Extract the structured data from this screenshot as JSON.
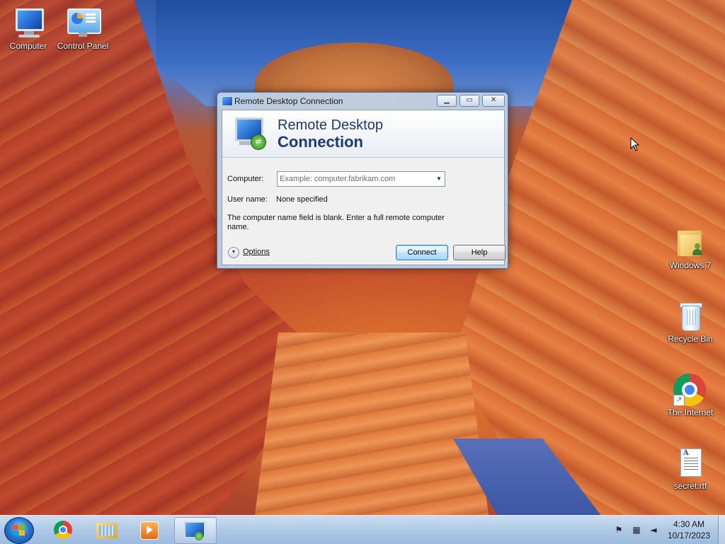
{
  "desktop": {
    "icons": [
      {
        "label": "Computer",
        "icon": "computer-icon"
      },
      {
        "label": "Control Panel",
        "icon": "control-panel-icon"
      },
      {
        "label": "Windows 7",
        "icon": "user-folder-icon"
      },
      {
        "label": "Recycle Bin",
        "icon": "recycle-bin-icon"
      },
      {
        "label": "The Internet",
        "icon": "chrome-shortcut-icon"
      },
      {
        "label": "secret.rtf",
        "icon": "rtf-document-icon"
      }
    ]
  },
  "dialog": {
    "title": "Remote Desktop Connection",
    "banner_line1": "Remote Desktop",
    "banner_line2": "Connection",
    "computer_label": "Computer:",
    "computer_value": "",
    "computer_placeholder": "Example: computer.fabrikam.com",
    "username_label": "User name:",
    "username_value": "None specified",
    "message": "The computer name field is blank. Enter a full remote computer name.",
    "options_label": "Options",
    "connect_label": "Connect",
    "help_label": "Help"
  },
  "taskbar": {
    "pinned": [
      {
        "name": "Google Chrome",
        "icon": "chrome-icon"
      },
      {
        "name": "Windows Explorer",
        "icon": "explorer-icon"
      },
      {
        "name": "Windows Media Player",
        "icon": "media-player-icon"
      },
      {
        "name": "Remote Desktop Connection",
        "icon": "remote-desktop-icon",
        "active": true
      }
    ],
    "tray_icons": [
      "action-center-flag-icon",
      "network-icon",
      "volume-muted-icon"
    ],
    "time": "4:30 AM",
    "date": "10/17/2023"
  },
  "colors": {
    "accent": "#1a3a78",
    "connect_button": "#bee6fd",
    "taskbar": "#aac6e4"
  }
}
